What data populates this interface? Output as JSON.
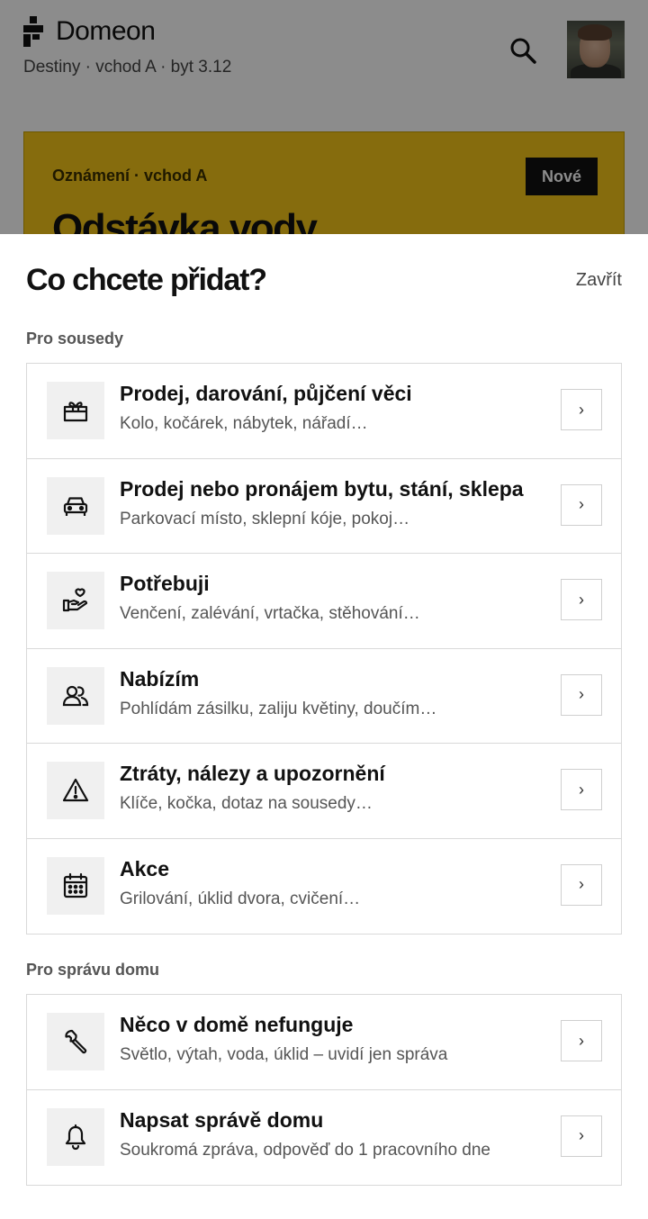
{
  "app": {
    "brand": "Domeon",
    "subtitle": "Destiny · vchod A · byt 3.12",
    "notice": {
      "tag": "Oznámení · vchod A",
      "badge": "Nové",
      "title": "Odstávka vody"
    }
  },
  "sheet": {
    "title": "Co chcete přidat?",
    "close_label": "Zavřít",
    "sections": [
      {
        "label": "Pro sousedy",
        "items": [
          {
            "title": "Prodej, darování, půjčení věci",
            "subtitle": "Kolo, kočárek, nábytek, nářadí…",
            "icon": "gift-icon",
            "arrow": "›"
          },
          {
            "title": "Prodej nebo pronájem bytu, stání, sklepa",
            "subtitle": "Parkovací místo, sklepní kóje, pokoj…",
            "icon": "car-icon",
            "arrow": "›"
          },
          {
            "title": "Potřebuji",
            "subtitle": "Venčení, zalévání, vrtačka, stěhování…",
            "icon": "hand-heart-icon",
            "arrow": "›"
          },
          {
            "title": "Nabízím",
            "subtitle": "Pohlídám zásilku, zaliju květiny, doučím…",
            "icon": "users-icon",
            "arrow": "›"
          },
          {
            "title": "Ztráty, nálezy a upozornění",
            "subtitle": "Klíče, kočka, dotaz na sousedy…",
            "icon": "warning-icon",
            "arrow": "›"
          },
          {
            "title": "Akce",
            "subtitle": "Grilování, úklid dvora, cvičení…",
            "icon": "calendar-icon",
            "arrow": "›"
          }
        ]
      },
      {
        "label": "Pro správu domu",
        "items": [
          {
            "title": "Něco v domě nefunguje",
            "subtitle": "Světlo, výtah, voda, úklid – uvidí jen správa",
            "icon": "wrench-icon",
            "arrow": "›"
          },
          {
            "title": "Napsat správě domu",
            "subtitle": "Soukromá zpráva, odpověď do 1 pracovního dne",
            "icon": "bell-icon",
            "arrow": "›"
          }
        ]
      }
    ]
  }
}
